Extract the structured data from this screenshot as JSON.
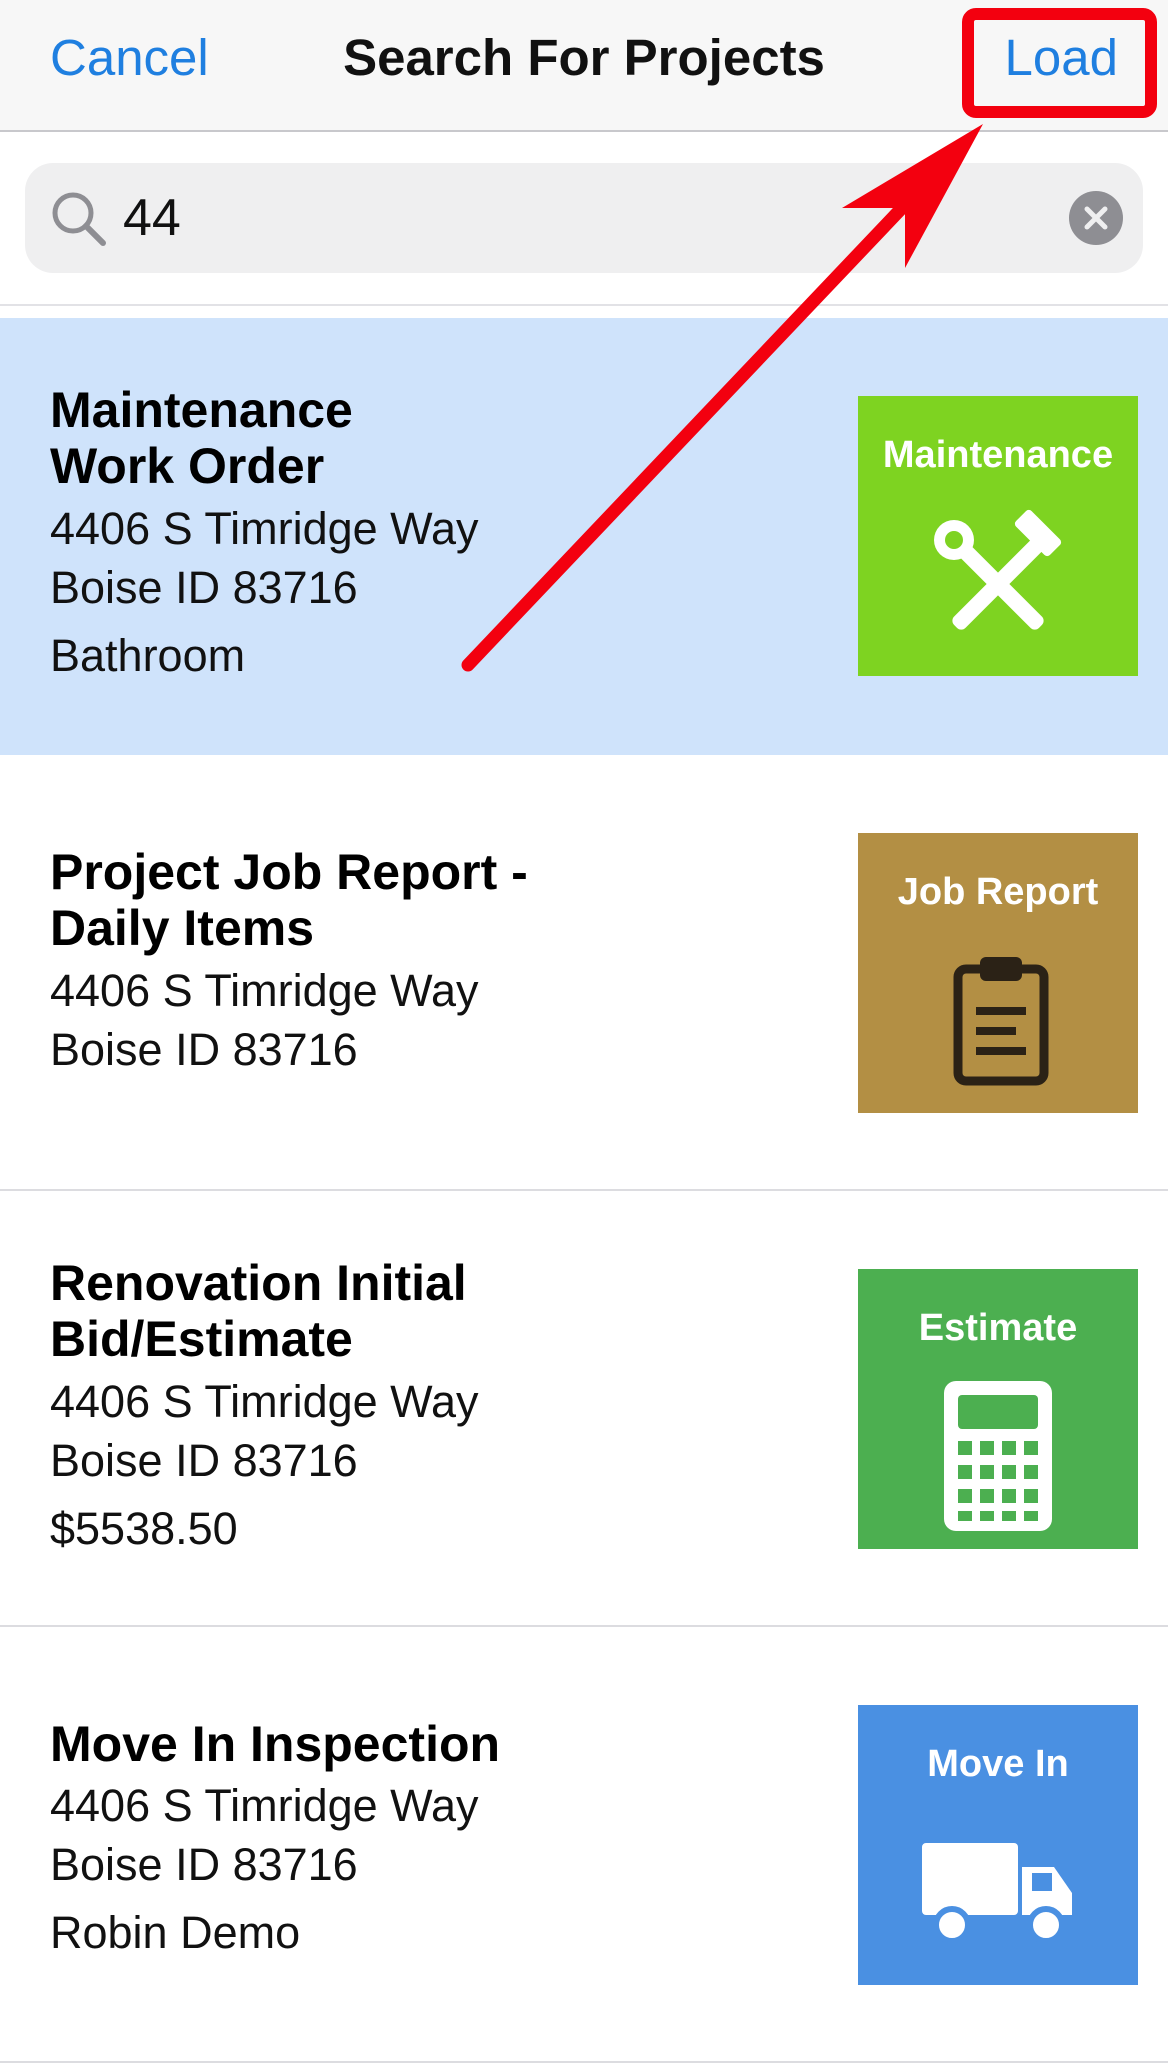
{
  "nav": {
    "cancel_label": "Cancel",
    "title": "Search For Projects",
    "load_label": "Load"
  },
  "search": {
    "value": "44",
    "icon": "search-icon",
    "clear_icon": "clear-icon"
  },
  "results": [
    {
      "title": "Maintenance\nWork Order",
      "address1": "4406 S Timridge Way",
      "address2": "Boise ID 83716",
      "extra": "Bathroom",
      "selected": true,
      "tile": {
        "label": "Maintenance",
        "color": "#7ed321",
        "icon": "tools-icon"
      }
    },
    {
      "title": "Project Job Report -\nDaily Items",
      "address1": "4406 S Timridge Way",
      "address2": "Boise ID 83716",
      "extra": "",
      "selected": false,
      "tile": {
        "label": "Job Report",
        "color": "#b38f44",
        "icon": "clipboard-icon"
      }
    },
    {
      "title": "Renovation Initial\nBid/Estimate",
      "address1": "4406 S Timridge Way",
      "address2": "Boise ID 83716",
      "extra": "$5538.50",
      "selected": false,
      "tile": {
        "label": "Estimate",
        "color": "#4caf50",
        "icon": "calculator-icon"
      }
    },
    {
      "title": "Move In Inspection",
      "address1": "4406 S Timridge Way",
      "address2": "Boise ID 83716",
      "extra": "Robin Demo",
      "selected": false,
      "tile": {
        "label": "Move In",
        "color": "#4a90e2",
        "icon": "truck-icon"
      }
    }
  ],
  "colors": {
    "accent": "#1f7fe0",
    "selected_row": "#cfe3fb",
    "annotation_red": "#f3000f"
  }
}
